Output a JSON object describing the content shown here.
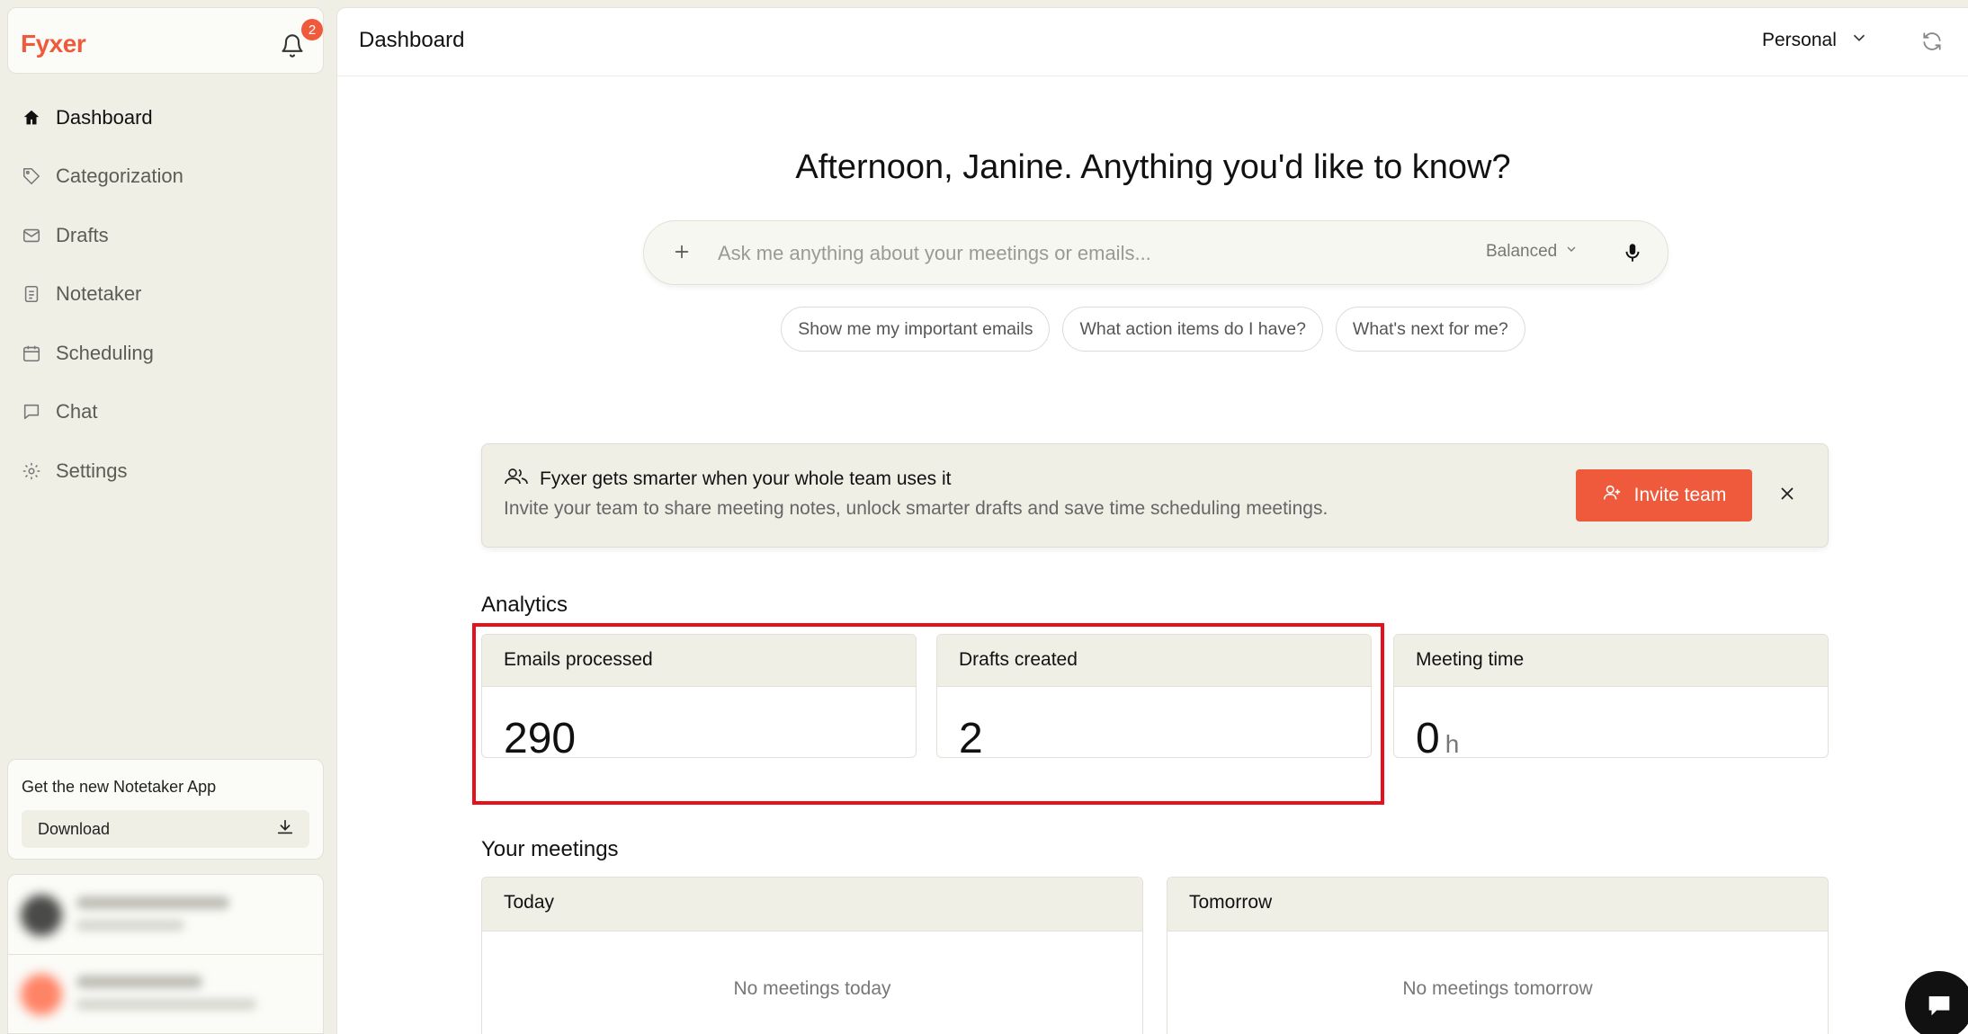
{
  "brand": {
    "name": "Fyxer",
    "notification_count": "2"
  },
  "sidebar": {
    "items": [
      {
        "label": "Dashboard",
        "icon": "home-icon",
        "active": true
      },
      {
        "label": "Categorization",
        "icon": "tag-icon"
      },
      {
        "label": "Drafts",
        "icon": "mail-icon"
      },
      {
        "label": "Notetaker",
        "icon": "notes-icon"
      },
      {
        "label": "Scheduling",
        "icon": "calendar-icon"
      },
      {
        "label": "Chat",
        "icon": "chat-icon"
      },
      {
        "label": "Settings",
        "icon": "gear-icon"
      }
    ],
    "notetaker_promo": {
      "title": "Get the new Notetaker App",
      "button": "Download"
    }
  },
  "header": {
    "title": "Dashboard",
    "workspace": "Personal"
  },
  "assistant": {
    "greeting": "Afternoon, Janine. Anything you'd like to know?",
    "placeholder": "Ask me anything about your meetings or emails...",
    "mode": "Balanced",
    "suggestions": [
      "Show me my important emails",
      "What action items do I have?",
      "What's next for me?"
    ]
  },
  "invite_banner": {
    "title": "Fyxer gets smarter when your whole team uses it",
    "subtitle": "Invite your team to share meeting notes, unlock smarter drafts and save time scheduling meetings.",
    "button": "Invite team"
  },
  "analytics": {
    "title": "Analytics",
    "cards": [
      {
        "label": "Emails processed",
        "value": "290",
        "unit": ""
      },
      {
        "label": "Drafts created",
        "value": "2",
        "unit": ""
      },
      {
        "label": "Meeting time",
        "value": "0",
        "unit": "h"
      }
    ]
  },
  "meetings": {
    "title": "Your meetings",
    "columns": [
      {
        "label": "Today",
        "empty": "No meetings today"
      },
      {
        "label": "Tomorrow",
        "empty": "No meetings tomorrow"
      }
    ]
  },
  "colors": {
    "accent": "#f05a3c",
    "highlight": "#e5121d",
    "panel": "#efefe6"
  }
}
